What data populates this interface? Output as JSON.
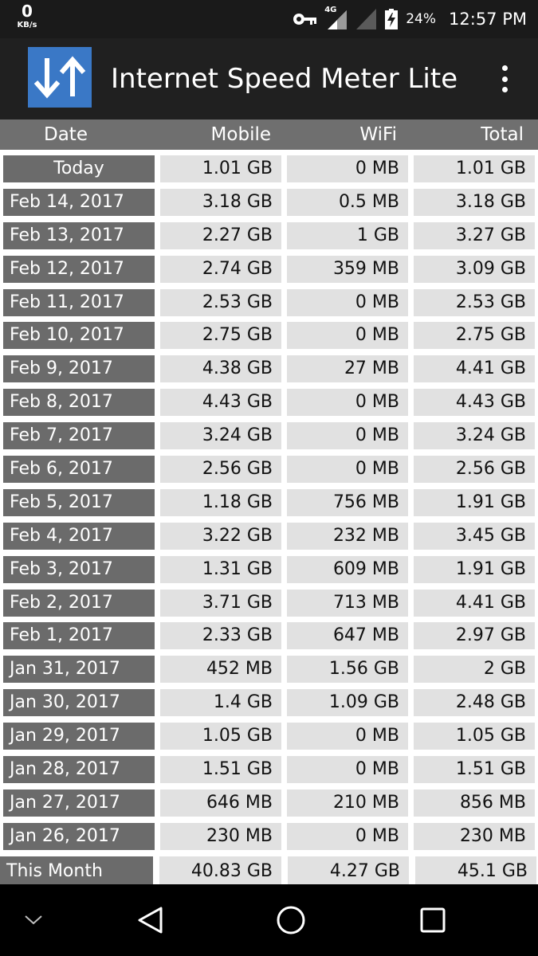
{
  "status_bar": {
    "speed_value": "0",
    "speed_unit": "KB/s",
    "network": "4G",
    "battery_percent": "24%",
    "time": "12:57 PM",
    "icons": [
      "key-icon",
      "signal-4g-icon",
      "signal-icon",
      "battery-charging-icon"
    ]
  },
  "app_bar": {
    "title": "Internet Speed Meter Lite",
    "logo_color": "#3a78c6",
    "menu_icon": "more-vert-icon"
  },
  "table": {
    "columns": [
      "Date",
      "Mobile",
      "WiFi",
      "Total"
    ],
    "rows": [
      {
        "date": "Today",
        "mobile": "1.01 GB",
        "wifi": "0 MB",
        "total": "1.01 GB"
      },
      {
        "date": "Feb 14, 2017",
        "mobile": "3.18 GB",
        "wifi": "0.5 MB",
        "total": "3.18 GB"
      },
      {
        "date": "Feb 13, 2017",
        "mobile": "2.27 GB",
        "wifi": "1 GB",
        "total": "3.27 GB"
      },
      {
        "date": "Feb 12, 2017",
        "mobile": "2.74 GB",
        "wifi": "359 MB",
        "total": "3.09 GB"
      },
      {
        "date": "Feb 11, 2017",
        "mobile": "2.53 GB",
        "wifi": "0 MB",
        "total": "2.53 GB"
      },
      {
        "date": "Feb 10, 2017",
        "mobile": "2.75 GB",
        "wifi": "0 MB",
        "total": "2.75 GB"
      },
      {
        "date": "Feb 9, 2017",
        "mobile": "4.38 GB",
        "wifi": "27 MB",
        "total": "4.41 GB"
      },
      {
        "date": "Feb 8, 2017",
        "mobile": "4.43 GB",
        "wifi": "0 MB",
        "total": "4.43 GB"
      },
      {
        "date": "Feb 7, 2017",
        "mobile": "3.24 GB",
        "wifi": "0 MB",
        "total": "3.24 GB"
      },
      {
        "date": "Feb 6, 2017",
        "mobile": "2.56 GB",
        "wifi": "0 MB",
        "total": "2.56 GB"
      },
      {
        "date": "Feb 5, 2017",
        "mobile": "1.18 GB",
        "wifi": "756 MB",
        "total": "1.91 GB"
      },
      {
        "date": "Feb 4, 2017",
        "mobile": "3.22 GB",
        "wifi": "232 MB",
        "total": "3.45 GB"
      },
      {
        "date": "Feb 3, 2017",
        "mobile": "1.31 GB",
        "wifi": "609 MB",
        "total": "1.91 GB"
      },
      {
        "date": "Feb 2, 2017",
        "mobile": "3.71 GB",
        "wifi": "713 MB",
        "total": "4.41 GB"
      },
      {
        "date": "Feb 1, 2017",
        "mobile": "2.33 GB",
        "wifi": "647 MB",
        "total": "2.97 GB"
      },
      {
        "date": "Jan 31, 2017",
        "mobile": "452 MB",
        "wifi": "1.56 GB",
        "total": "2 GB"
      },
      {
        "date": "Jan 30, 2017",
        "mobile": "1.4 GB",
        "wifi": "1.09 GB",
        "total": "2.48 GB"
      },
      {
        "date": "Jan 29, 2017",
        "mobile": "1.05 GB",
        "wifi": "0 MB",
        "total": "1.05 GB"
      },
      {
        "date": "Jan 28, 2017",
        "mobile": "1.51 GB",
        "wifi": "0 MB",
        "total": "1.51 GB"
      },
      {
        "date": "Jan 27, 2017",
        "mobile": "646 MB",
        "wifi": "210 MB",
        "total": "856 MB"
      },
      {
        "date": "Jan 26, 2017",
        "mobile": "230 MB",
        "wifi": "0 MB",
        "total": "230 MB"
      }
    ],
    "summary": {
      "label": "This Month",
      "mobile": "40.83 GB",
      "wifi": "4.27 GB",
      "total": "45.1 GB"
    }
  },
  "nav_bar": {
    "icons": [
      "chevron-down-icon",
      "back-icon",
      "home-icon",
      "recents-icon"
    ]
  }
}
